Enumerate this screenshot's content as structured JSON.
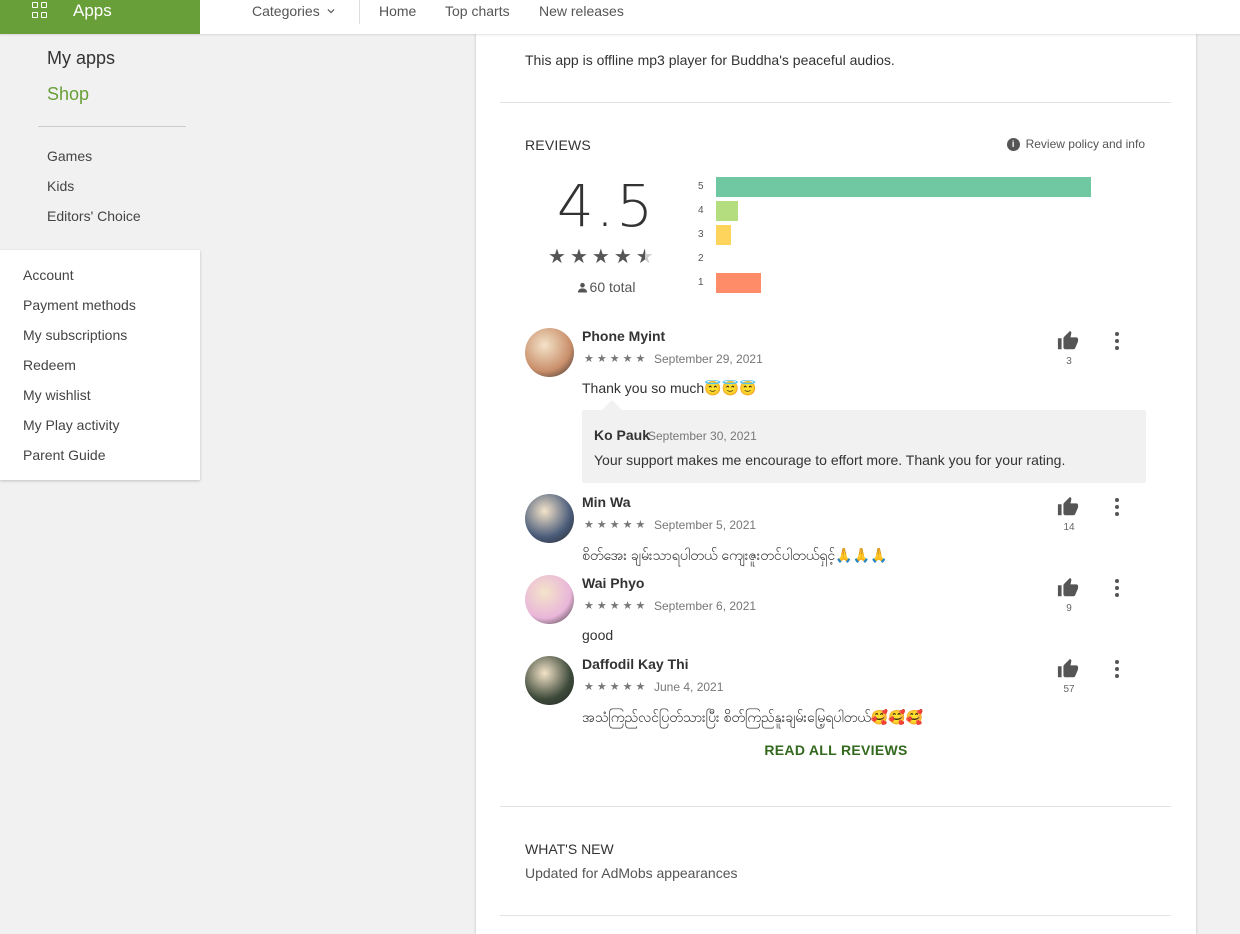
{
  "topbar": {
    "apps_label": "Apps",
    "categories_label": "Categories",
    "nav": [
      "Home",
      "Top charts",
      "New releases"
    ]
  },
  "sidebar": {
    "my_apps": "My apps",
    "shop": "Shop",
    "sub_items": [
      "Games",
      "Kids",
      "Editors' Choice"
    ],
    "account_items": [
      "Account",
      "Payment methods",
      "My subscriptions",
      "Redeem",
      "My wishlist",
      "My Play activity",
      "Parent Guide"
    ]
  },
  "main": {
    "description": "This app is offline mp3 player for Buddha's peaceful audios.",
    "reviews_title": "REVIEWS",
    "policy_label": "Review policy and info",
    "score": "4.5",
    "stars_full": 4,
    "stars_half": true,
    "total": "60 total",
    "histogram": [
      {
        "label": "5",
        "fraction": 1.0,
        "color": "#6fc8a2"
      },
      {
        "label": "4",
        "fraction": 0.058,
        "color": "#b3dd7f"
      },
      {
        "label": "3",
        "fraction": 0.04,
        "color": "#ffd45c"
      },
      {
        "label": "2",
        "fraction": 0.0,
        "color": "#ffb14f"
      },
      {
        "label": "1",
        "fraction": 0.12,
        "color": "#ff8c69"
      }
    ],
    "reviews": [
      {
        "name": "Phone Myint",
        "stars": 5,
        "date": "September 29, 2021",
        "text": "Thank you so much😇😇😇",
        "likes": "3",
        "avatar_color": "#c98f6b",
        "reply": {
          "name": "Ko Pauk",
          "date": "September 30, 2021",
          "text": "Your support makes me encourage to effort more. Thank you for your rating."
        }
      },
      {
        "name": "Min Wa",
        "stars": 5,
        "date": "September 5, 2021",
        "text": "စိတ်အေး ချမ်းသာရပါတယ် ကျေးဇူးတင်ပါတယ်ရှင့်🙏🙏🙏",
        "likes": "14",
        "avatar_color": "#4a5c7a"
      },
      {
        "name": "Wai Phyo",
        "stars": 5,
        "date": "September 6, 2021",
        "text": "good",
        "likes": "9",
        "avatar_color": "#e9b6d9"
      },
      {
        "name": "Daffodil Kay Thi",
        "stars": 5,
        "date": "June 4, 2021",
        "text": "အသံကြည်လင်ပြတ်သားပြီး စိတ်ကြည်နူးချမ်းမြေ့ရပါတယ်🥰🥰🥰",
        "likes": "57",
        "avatar_color": "#3d4a3a"
      }
    ],
    "read_all": "READ ALL REVIEWS",
    "whats_new_title": "WHAT'S NEW",
    "whats_new_text": "Updated for AdMobs appearances"
  }
}
